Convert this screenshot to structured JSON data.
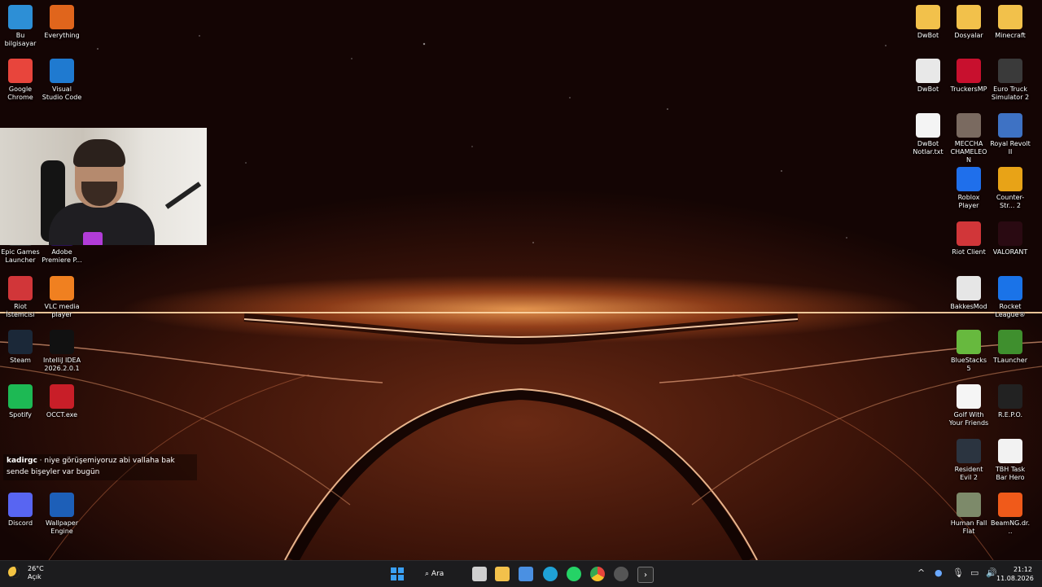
{
  "left_icons": [
    {
      "label": "Bu bilgisayar",
      "icon": "computer-icon",
      "color": "#2d8fd6"
    },
    {
      "label": "Everything",
      "icon": "search-icon",
      "color": "#e0651c"
    },
    {
      "label": "Google Chrome",
      "icon": "chrome-icon",
      "color": "#e8453c"
    },
    {
      "label": "Visual Studio Code",
      "icon": "vscode-icon",
      "color": "#1f7ad0"
    },
    {
      "label": "Epic Games Launcher",
      "icon": "epic-icon",
      "color": "#333"
    },
    {
      "label": "Adobe Premiere P...",
      "icon": "premiere-icon",
      "color": "#2a1356"
    },
    {
      "label": "Riot İstemcisi",
      "icon": "riot-icon",
      "color": "#d13639"
    },
    {
      "label": "VLC media player",
      "icon": "vlc-icon",
      "color": "#f08020"
    },
    {
      "label": "Steam",
      "icon": "steam-icon",
      "color": "#1b2838"
    },
    {
      "label": "IntelliJ IDEA 2026.2.0.1",
      "icon": "intellij-icon",
      "color": "#111"
    },
    {
      "label": "Spotify",
      "icon": "spotify-icon",
      "color": "#1db954"
    },
    {
      "label": "OCCT.exe",
      "icon": "occt-icon",
      "color": "#c81e28"
    },
    {
      "label": "Discord",
      "icon": "discord-icon",
      "color": "#5865f2"
    },
    {
      "label": "Wallpaper Engine",
      "icon": "wallpaper-engine-icon",
      "color": "#1d5fb8"
    }
  ],
  "right_icons": [
    {
      "label": "DwBot",
      "icon": "folder-icon",
      "color": "#f2c14b"
    },
    {
      "label": "Dosyalar",
      "icon": "folder-icon",
      "color": "#f2c14b"
    },
    {
      "label": "Minecraft",
      "icon": "folder-icon",
      "color": "#f2c14b"
    },
    {
      "label": "DwBot",
      "icon": "settings-file-icon",
      "color": "#e8e8e8"
    },
    {
      "label": "TruckersMP",
      "icon": "truckersmp-icon",
      "color": "#c8102e"
    },
    {
      "label": "Euro Truck Simulator 2",
      "icon": "ets2-icon",
      "color": "#3a3a3a"
    },
    {
      "label": "DwBot Notlar.txt",
      "icon": "text-file-icon",
      "color": "#f4f4f4"
    },
    {
      "label": "MECCHA CHAMELEON",
      "icon": "game-icon",
      "color": "#7a6a60"
    },
    {
      "label": "Royal Revolt II",
      "icon": "royal-revolt-icon",
      "color": "#3e72c4"
    },
    {
      "label": "Roblox Player",
      "icon": "roblox-icon",
      "color": "#1f6feb"
    },
    {
      "label": "Counter-Str... 2",
      "icon": "cs2-icon",
      "color": "#e8a317"
    },
    {
      "label": "Riot Client",
      "icon": "riot-icon",
      "color": "#d13639"
    },
    {
      "label": "VALORANT",
      "icon": "valorant-icon",
      "color": "#2a0a12"
    },
    {
      "label": "BakkesMod",
      "icon": "bakkesmod-icon",
      "color": "#e6e6e6"
    },
    {
      "label": "Rocket League®",
      "icon": "rocket-league-icon",
      "color": "#1a73e8"
    },
    {
      "label": "BlueStacks 5",
      "icon": "bluestacks-icon",
      "color": "#67b93e"
    },
    {
      "label": "TLauncher",
      "icon": "tlauncher-icon",
      "color": "#3f8f2e"
    },
    {
      "label": "Golf With Your Friends",
      "icon": "golf-icon",
      "color": "#f5f5f5"
    },
    {
      "label": "R.E.P.O.",
      "icon": "repo-icon",
      "color": "#222"
    },
    {
      "label": "Resident Evil 2",
      "icon": "re2-icon",
      "color": "#2b3440"
    },
    {
      "label": "TBH Task Bar Hero",
      "icon": "tbh-icon",
      "color": "#f2f2f2"
    },
    {
      "label": "Human Fall Flat",
      "icon": "hff-icon",
      "color": "#7d8a6a"
    },
    {
      "label": "BeamNG.dr...",
      "icon": "beamng-icon",
      "color": "#f05a1a"
    }
  ],
  "chat": {
    "user": "kadirgc",
    "message": "niye görüşemiyoruz abi vallaha bak sende bişeyler var bugün"
  },
  "taskbar": {
    "weather_temp": "26°C",
    "weather_desc": "Açık",
    "search_label": "Ara",
    "time": "21:12",
    "date": "11.08.2026",
    "apps": [
      {
        "icon": "windows-start-icon",
        "color": "#3aa0f3"
      },
      {
        "icon": "task-view-icon",
        "color": "#cfcfcf"
      },
      {
        "icon": "file-explorer-icon",
        "color": "#f2c14b"
      },
      {
        "icon": "store-icon",
        "color": "#4a90e2"
      },
      {
        "icon": "edge-icon",
        "color": "#1fa2d6"
      },
      {
        "icon": "whatsapp-icon",
        "color": "#25d366"
      },
      {
        "icon": "chrome-icon",
        "color": "#e8453c"
      },
      {
        "icon": "obs-icon",
        "color": "#555"
      },
      {
        "icon": "terminal-icon",
        "color": "#2b2b2b"
      }
    ]
  }
}
